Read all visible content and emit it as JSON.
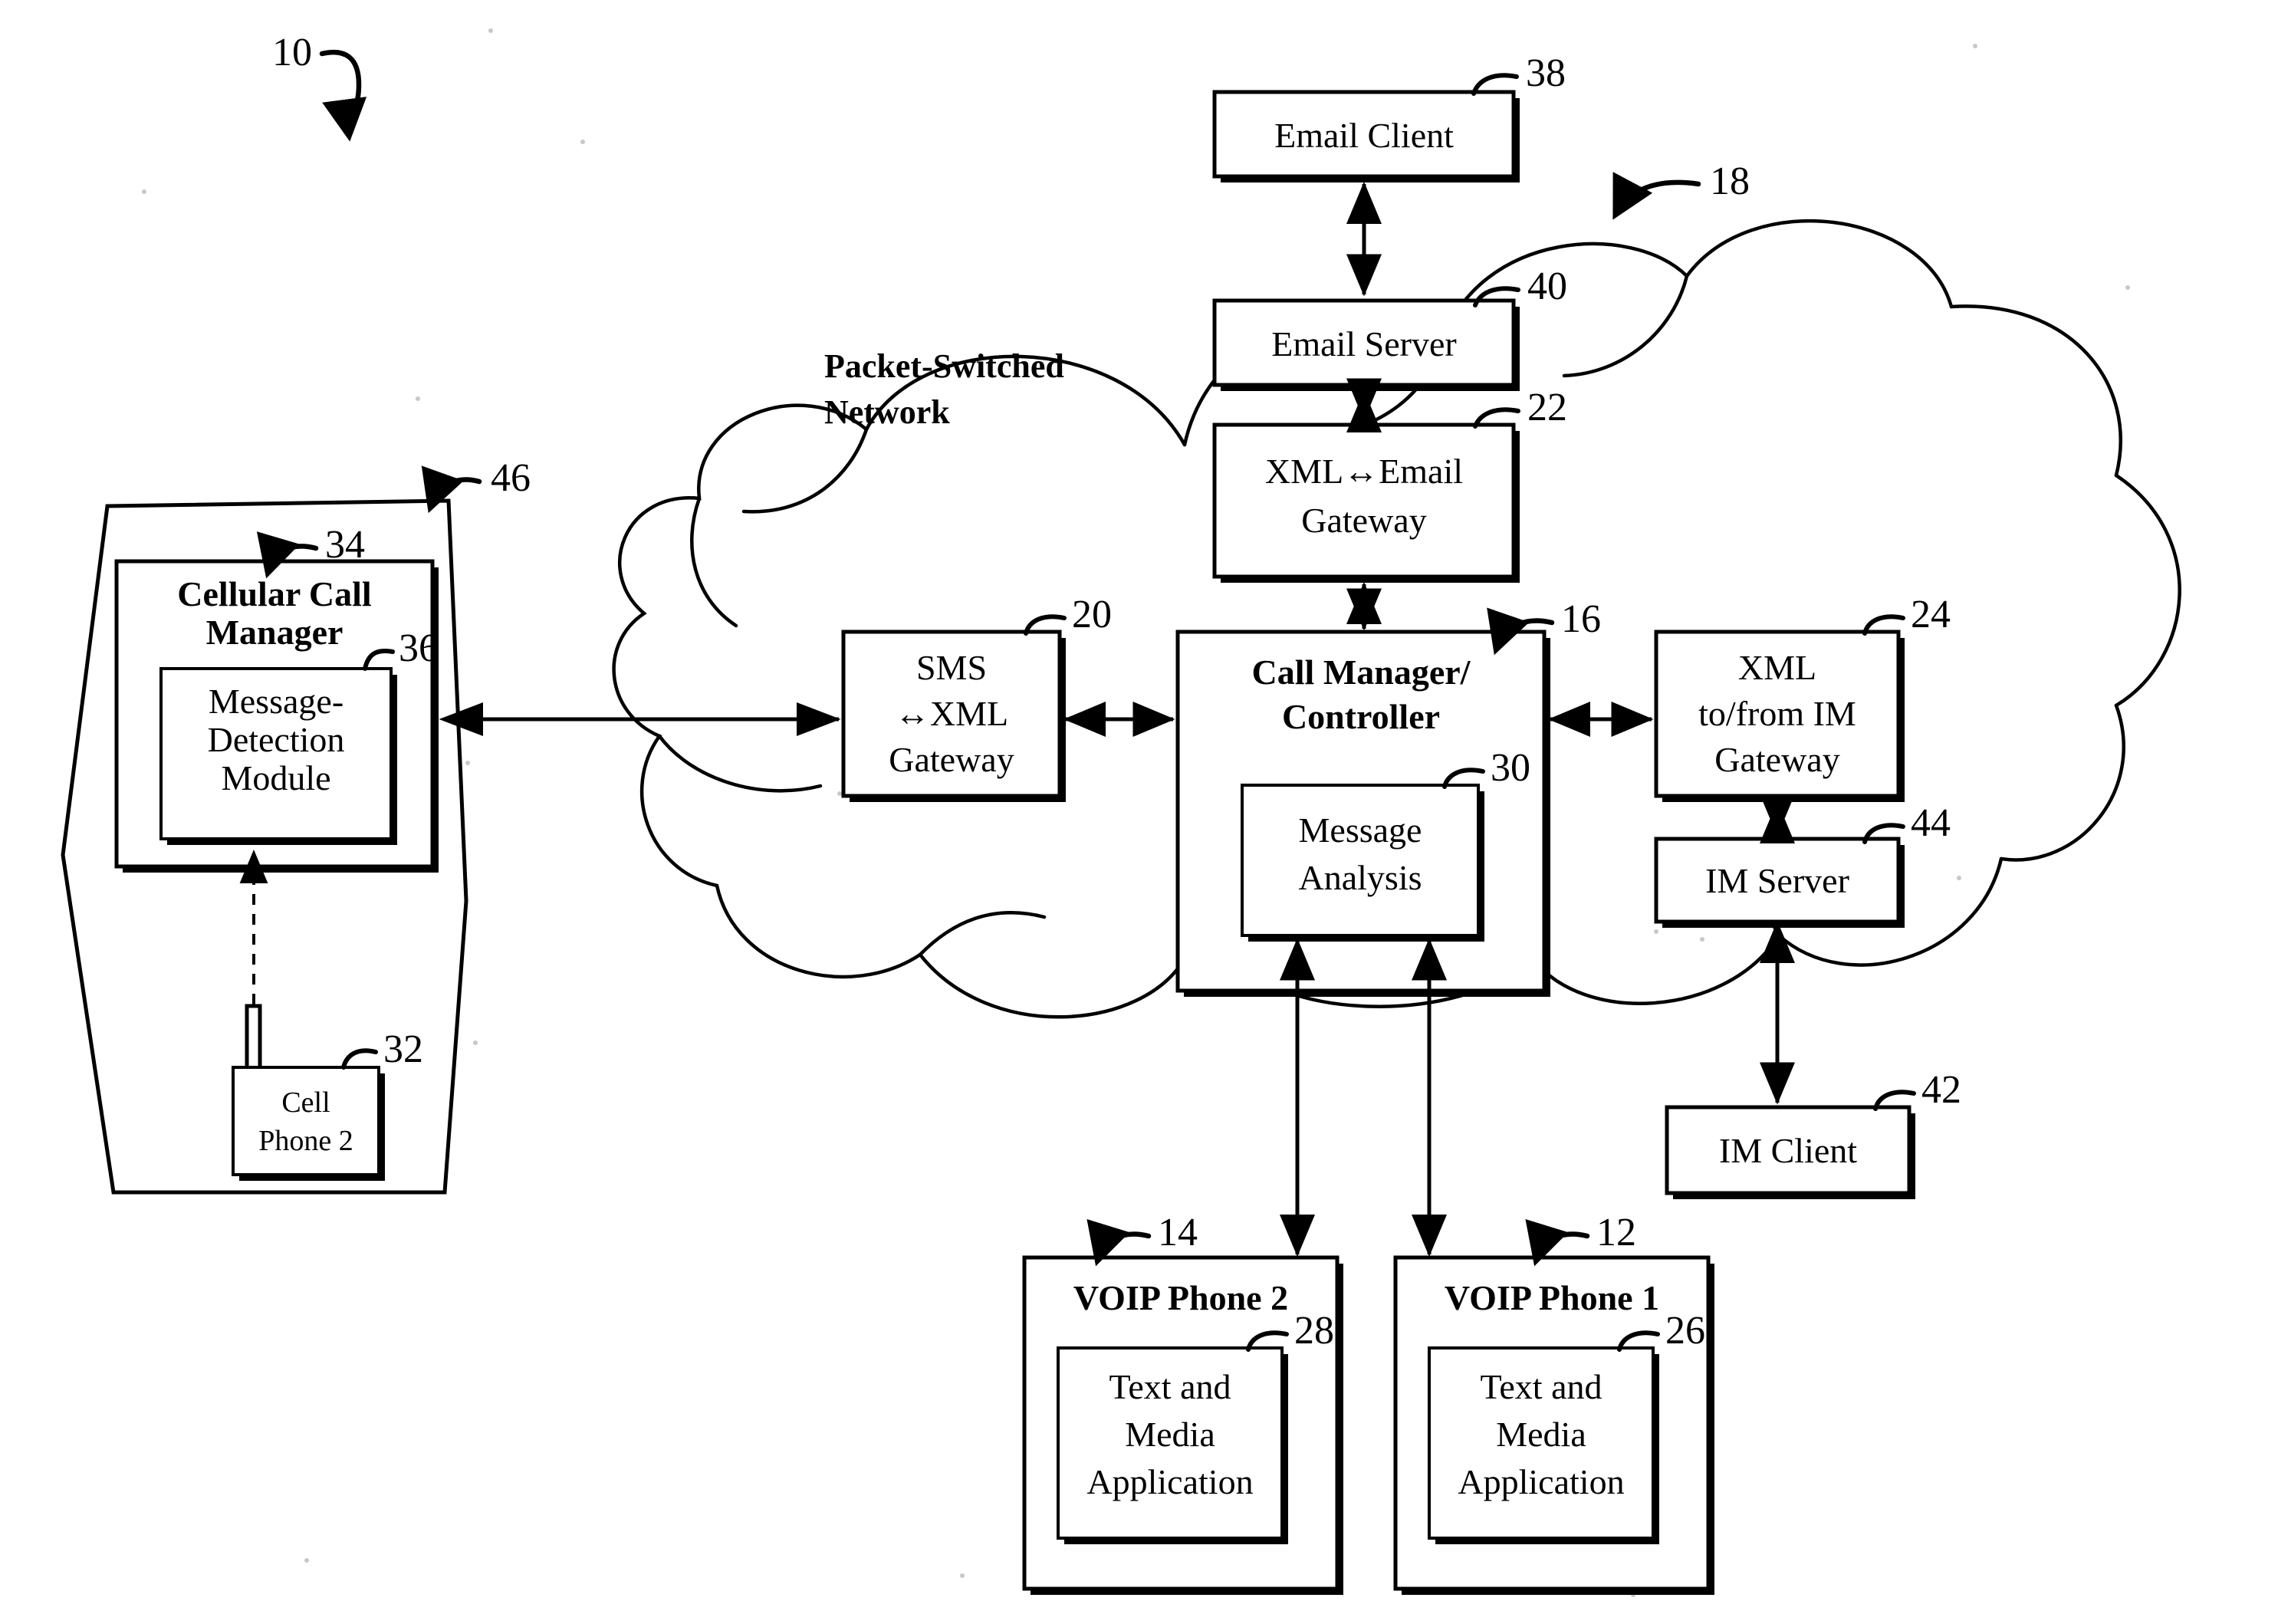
{
  "figure": {
    "ref_number": "10",
    "cloud_label_line1": "Packet-Switched",
    "cloud_label_line2": "Network",
    "cloud_ref": "18"
  },
  "nodes": {
    "email_client": {
      "label": "Email Client",
      "ref": "38"
    },
    "email_server": {
      "label": "Email Server",
      "ref": "40"
    },
    "xml_email_gw": {
      "line1": "XML↔Email",
      "line2": "Gateway",
      "ref": "22"
    },
    "sms_xml_gw": {
      "line1": "SMS",
      "line2": "↔XML",
      "line3": "Gateway",
      "ref": "20"
    },
    "call_manager": {
      "line1": "Call Manager/",
      "line2": "Controller",
      "ref": "16"
    },
    "message_analysis": {
      "line1": "Message",
      "line2": "Analysis",
      "ref": "30"
    },
    "xml_im_gw": {
      "line1": "XML",
      "line2": "to/from IM",
      "line3": "Gateway",
      "ref": "24"
    },
    "im_server": {
      "label": "IM Server",
      "ref": "44"
    },
    "im_client": {
      "label": "IM Client",
      "ref": "42"
    },
    "cellular_region": {
      "ref": "46"
    },
    "cellular_call_manager": {
      "line1": "Cellular Call",
      "line2": "Manager",
      "ref": "34"
    },
    "message_detection": {
      "line1": "Message-",
      "line2": "Detection",
      "line3": "Module",
      "ref": "36"
    },
    "cell_phone_2": {
      "line1": "Cell",
      "line2": "Phone 2",
      "ref": "32"
    },
    "voip_phone_2": {
      "label": "VOIP Phone 2",
      "ref": "14"
    },
    "voip_phone_1": {
      "label": "VOIP Phone 1",
      "ref": "12"
    },
    "text_media_app_2": {
      "line1": "Text and",
      "line2": "Media",
      "line3": "Application",
      "ref": "28"
    },
    "text_media_app_1": {
      "line1": "Text and",
      "line2": "Media",
      "line3": "Application",
      "ref": "26"
    }
  },
  "colors": {
    "ink": "#000000",
    "paper": "#ffffff"
  }
}
